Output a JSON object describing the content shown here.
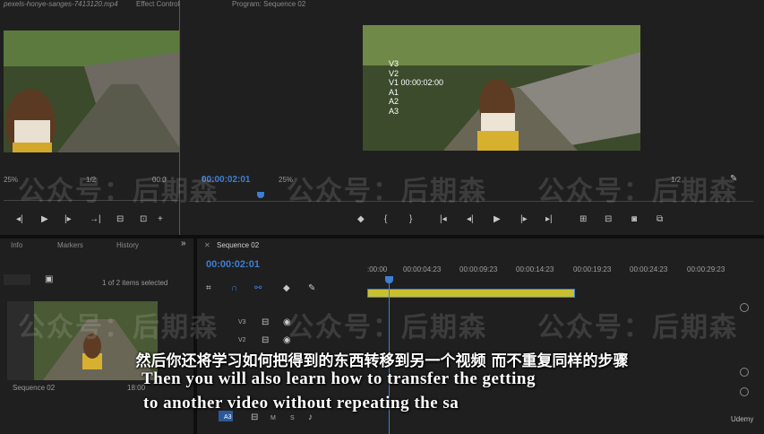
{
  "source_panel": {
    "tab_clip": "pexels-honye-sanges-7413120.mp4",
    "tab_effect": "Effect Controls",
    "zoom": "25%",
    "resolution": "1/2",
    "timecode_right": "00:0"
  },
  "program_panel": {
    "tab_title": "Program: Sequence 02",
    "timecode": "00:00:02:01",
    "zoom": "25%",
    "resolution": "1/2",
    "overlay_lines": [
      "V3",
      "V2",
      "V1 00:00:02:00",
      "A1",
      "A2",
      "A3"
    ]
  },
  "project_panel": {
    "tabs": [
      "Info",
      "Markers",
      "History"
    ],
    "items_count": "1 of 2 items selected",
    "thumb_label": "Sequence 02",
    "thumb_duration": "18:00"
  },
  "timeline": {
    "tab": "Sequence 02",
    "timecode": "00:00:02:01",
    "ruler": [
      ":00:00",
      "00:00:04:23",
      "00:00:09:23",
      "00:00:14:23",
      "00:00:19:23",
      "00:00:24:23",
      "00:00:29:23"
    ],
    "tracks": [
      "V3",
      "V2",
      "A3"
    ],
    "track_buttons": [
      "M",
      "S"
    ]
  },
  "watermark": "公众号：后期森",
  "subtitles": {
    "chinese": "然后你还将学习如何把得到的东西转移到另一个视频 而不重复同样的步骤",
    "english_line1": "Then you will also learn how to transfer the getting",
    "english_line2": "to another video without repeating the sa"
  },
  "brand": "Udemy",
  "colors": {
    "accent": "#3d7fd6",
    "panel": "#1f1f1f",
    "yellow": "#d8c838"
  }
}
